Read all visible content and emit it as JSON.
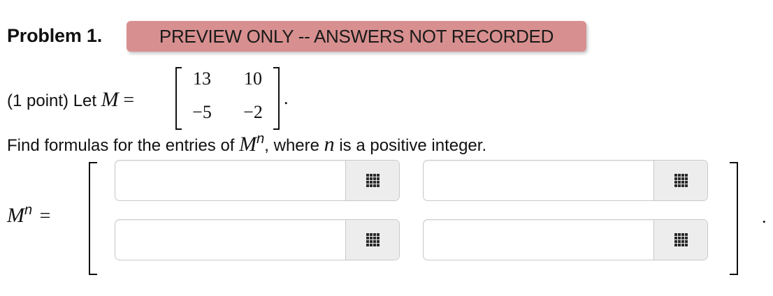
{
  "header": {
    "problem_title": "Problem 1.",
    "banner": "PREVIEW ONLY -- ANSWERS NOT RECORDED"
  },
  "intro": {
    "prefix": "(1 point) Let",
    "matrix_var": "M",
    "equals": "=",
    "matrix": {
      "r1c1": "13",
      "r1c2": "10",
      "r2c1": "−5",
      "r2c2": "−2"
    },
    "period": "."
  },
  "instruction": {
    "prefix": "Find formulas for the entries of",
    "base": "M",
    "exponent": "n",
    "middle": ", where",
    "var": "n",
    "suffix": "is a positive integer."
  },
  "answer": {
    "lhs_base": "M",
    "lhs_exponent": "n",
    "equals": "=",
    "period": ".",
    "inputs": [
      {
        "value": "",
        "placeholder": ""
      },
      {
        "value": "",
        "placeholder": ""
      },
      {
        "value": "",
        "placeholder": ""
      },
      {
        "value": "",
        "placeholder": ""
      }
    ],
    "matrix_button_icon": "grid-icon"
  },
  "colors": {
    "banner_bg": "#d7908f",
    "input_border": "#c9c9c9",
    "button_bg": "#ededed"
  }
}
